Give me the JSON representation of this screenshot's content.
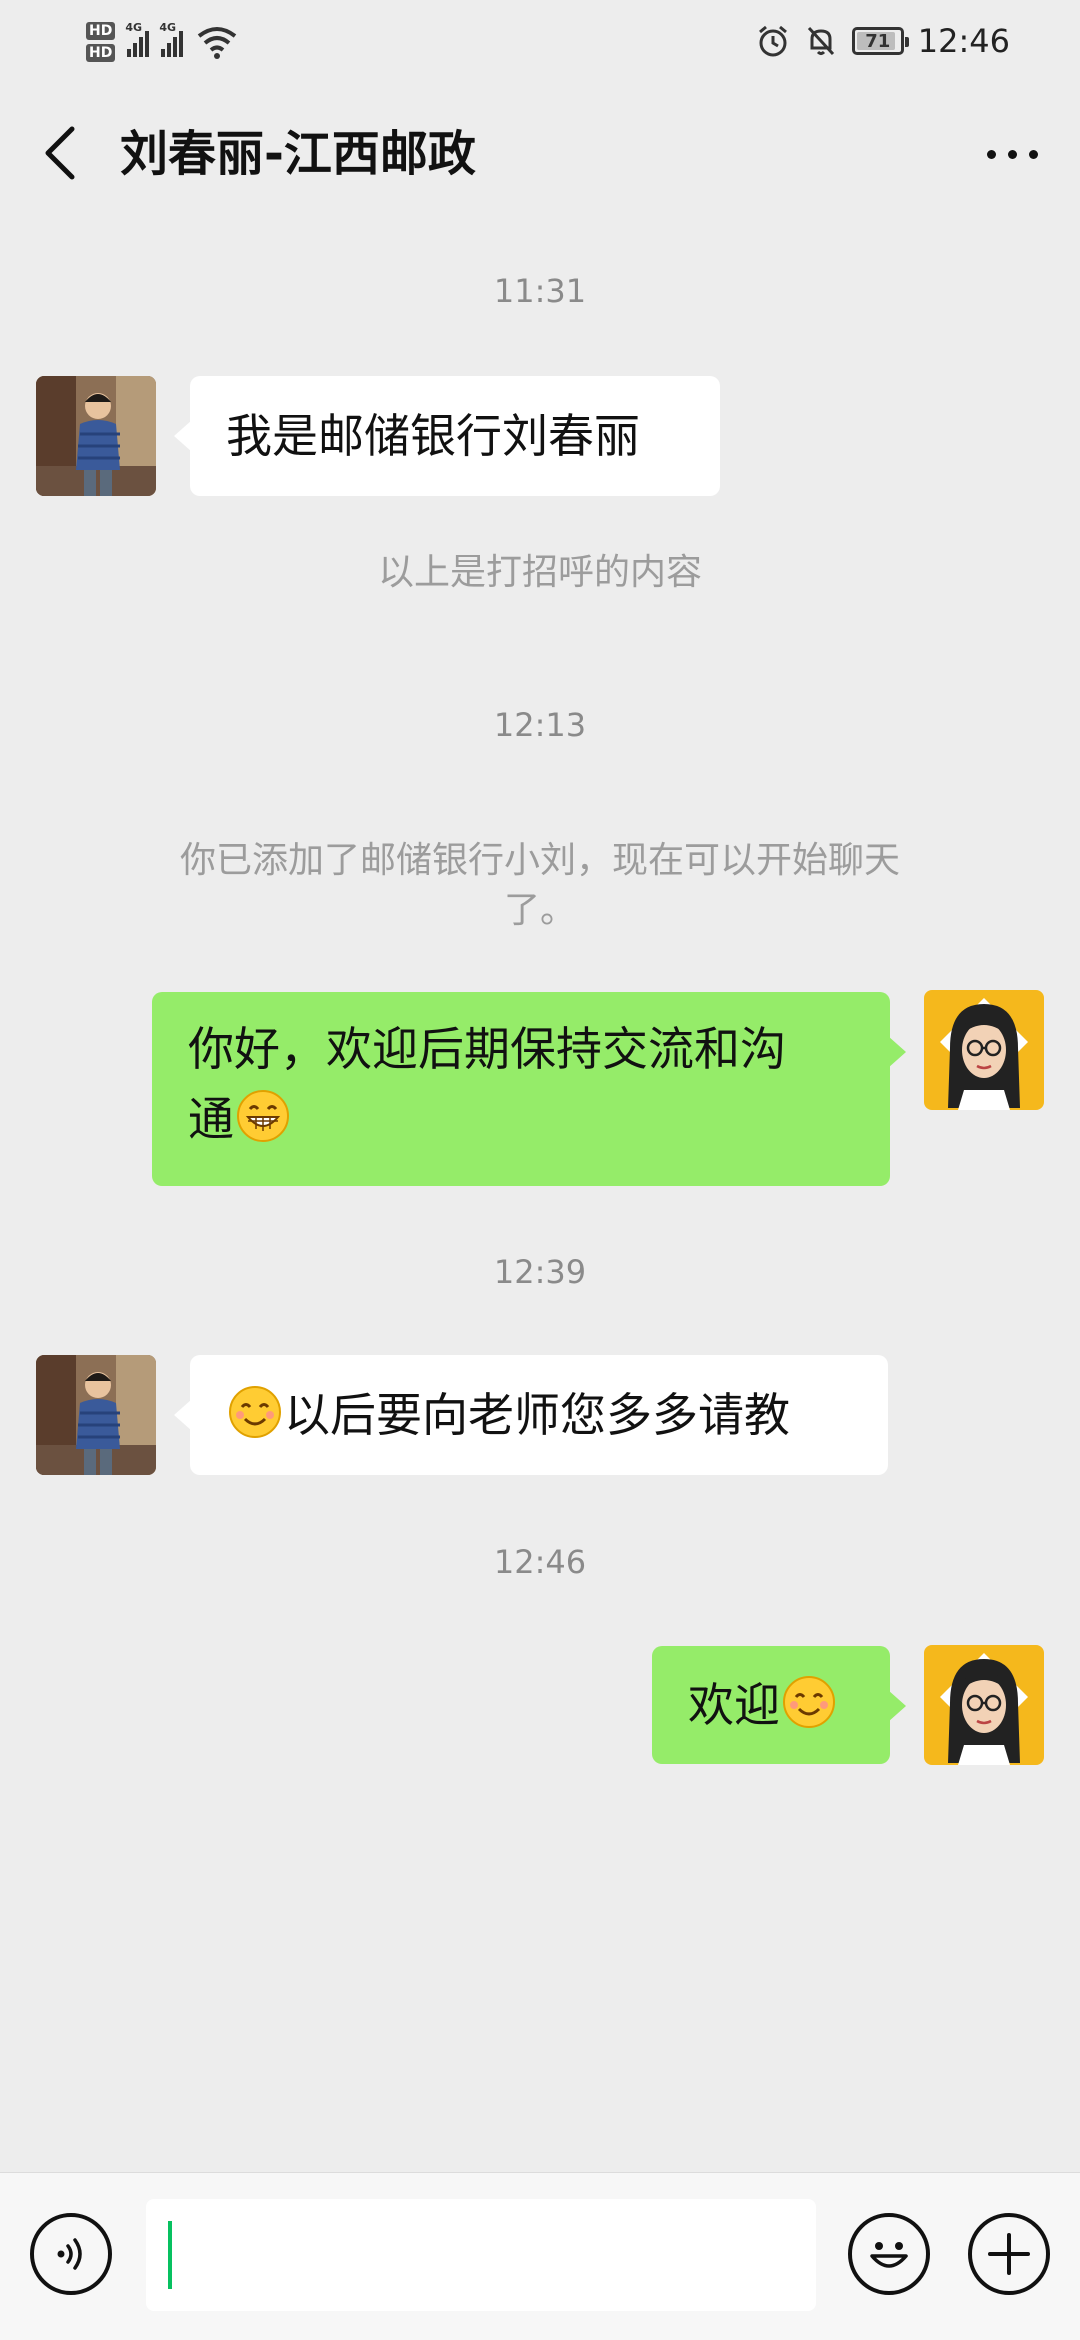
{
  "status_bar": {
    "hd1": "HD",
    "hd2": "HD",
    "net1": "4G",
    "net2": "4G",
    "battery": "71",
    "time": "12:46"
  },
  "header": {
    "title": "刘春丽-江西邮政"
  },
  "messages": {
    "time1": "11:31",
    "msg1": "我是邮储银行刘春丽",
    "sys1": "以上是打招呼的内容",
    "time2": "12:13",
    "sys2_line1": "你已添加了邮储银行小刘，现在可以开始聊天",
    "sys2_line2": "了。",
    "msg2_line1": "你好，欢迎后期保持交流和沟",
    "msg2_line2": "通",
    "time3": "12:39",
    "msg3": "以后要向老师您多多请教",
    "time4": "12:46",
    "msg4": "欢迎"
  },
  "icons": {
    "back": "chevron-left-icon",
    "more": "more-dots-icon",
    "voice": "voice-icon",
    "emoji": "emoji-icon",
    "plus": "plus-icon"
  },
  "colors": {
    "background": "#ededed",
    "outgoing_bubble": "#95ec69",
    "incoming_bubble": "#ffffff",
    "cursor": "#07c160"
  }
}
